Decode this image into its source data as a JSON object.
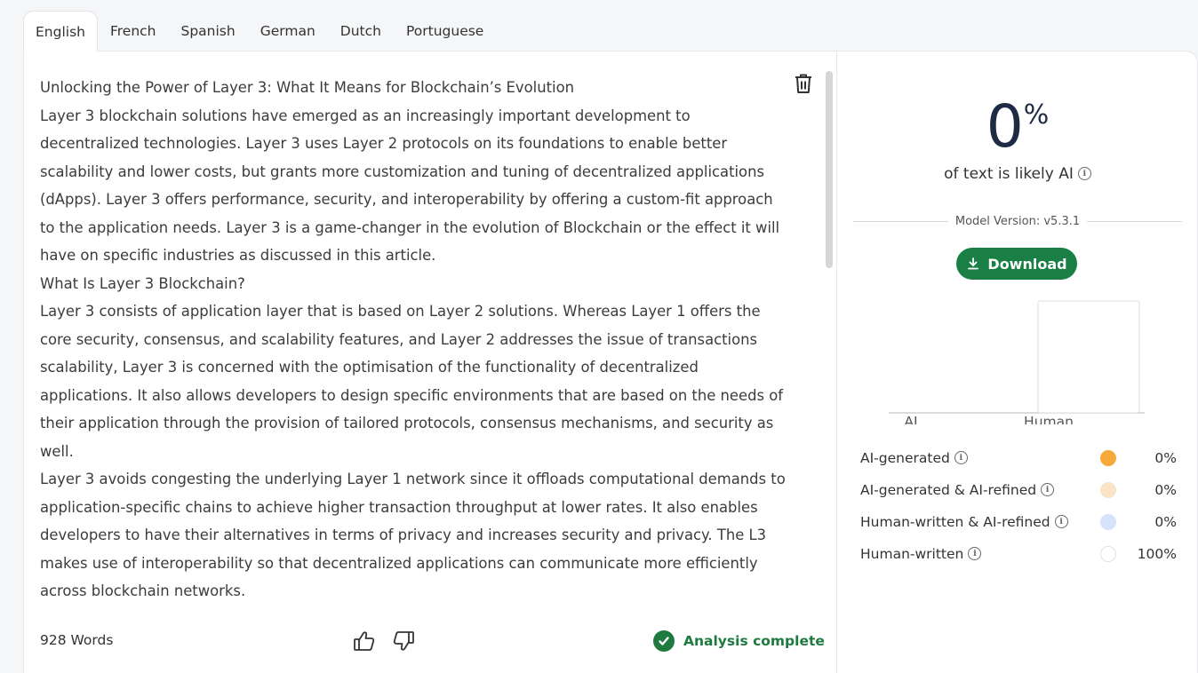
{
  "tabs": [
    "English",
    "French",
    "Spanish",
    "German",
    "Dutch",
    "Portuguese"
  ],
  "active_tab": "English",
  "editor": {
    "paragraphs": [
      "Unlocking the Power of Layer 3: What It Means for Blockchain’s Evolution",
      "Layer 3 blockchain solutions have emerged as an increasingly important development to decentralized technologies. Layer 3 uses Layer 2 protocols on its foundations to enable better scalability and lower costs, but grants more customization and tuning of decentralized applications (dApps). Layer 3 offers performance, security, and interoperability by offering a custom-fit approach to the application needs. Layer 3 is a game-changer in the evolution of Blockchain or the effect it will have on specific industries as discussed in this article.",
      "What Is Layer 3 Blockchain?",
      "Layer 3 consists of application layer that is based on Layer 2 solutions. Whereas Layer 1 offers the core security, consensus, and scalability features, and Layer 2 addresses the issue of transactions scalability, Layer 3 is concerned with the optimisation of the functionality of decentralized applications. It also allows developers to design specific environments that are based on the needs of their application through the provision of tailored protocols, consensus mechanisms, and security as well.",
      "Layer 3 avoids congesting the underlying Layer 1 network since it offloads computational demands to application-specific chains to achieve higher transaction throughput at lower rates. It also enables developers to have their alternatives in terms of privacy and increases security and privacy. The L3 makes use of interoperability so that decentralized applications can communicate more efficiently across blockchain networks."
    ],
    "word_count": "928 Words",
    "status": "Analysis complete"
  },
  "results": {
    "percent_value": "0",
    "percent_sign": "%",
    "likely_label": "of text is likely AI",
    "model_version": "Model Version: v5.3.1",
    "download_label": "Download",
    "breakdown": [
      {
        "name": "AI-generated",
        "value": "0%",
        "color": "#f7a93b",
        "border": "#f7a93b"
      },
      {
        "name": "AI-generated & AI-refined",
        "value": "0%",
        "color": "#fbe3c8",
        "border": "#fbe3c8"
      },
      {
        "name": "Human-written & AI-refined",
        "value": "0%",
        "color": "#d5e3fb",
        "border": "#d5e3fb"
      },
      {
        "name": "Human-written",
        "value": "100%",
        "color": "#ffffff",
        "border": "#e2e2e2"
      }
    ]
  },
  "chart_data": {
    "type": "bar",
    "categories": [
      "AI",
      "Human"
    ],
    "values": [
      0,
      100
    ],
    "ylim": [
      0,
      100
    ]
  }
}
